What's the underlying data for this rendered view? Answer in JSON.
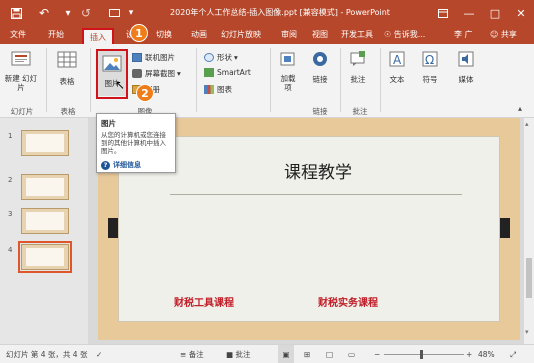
{
  "titlebar": {
    "title": "2020年个人工作总结-插入图像.ppt [兼容模式] - PowerPoint",
    "save_icon": "save-icon",
    "undo_icon": "undo-icon",
    "redo_icon": "redo-icon",
    "start_icon": "slideshow-start-icon"
  },
  "tabs": [
    "文件",
    "开始",
    "插入",
    "设计",
    "切换",
    "动画",
    "幻灯片放映",
    "审阅",
    "视图",
    "开发工具"
  ],
  "active_tab": "插入",
  "tellme": "告诉我...",
  "user": "李 广",
  "share": "共享",
  "ribbon": {
    "new_slide": "新建\n幻灯片",
    "table": "表格",
    "picture": "图片",
    "online_picture": "联机图片",
    "screenshot": "屏幕截图",
    "album": "相册",
    "shapes": "形状",
    "smartart": "SmartArt",
    "chart": "图表",
    "addins": "加载\n项",
    "link": "链接",
    "comment": "批注",
    "text": "文本",
    "symbol": "符号",
    "media": "媒体",
    "groups": {
      "slides": "幻灯片",
      "tables": "表格",
      "images": "图像",
      "links": "链接",
      "comments": "批注"
    }
  },
  "tooltip": {
    "title": "图片",
    "desc": "从您的计算机或您连接到的其他计算机中插入图片。",
    "more": "详细信息"
  },
  "thumbnails": [
    "1",
    "2",
    "3",
    "4"
  ],
  "slide": {
    "title": "课程教学",
    "sub_left": "财税工具课程",
    "sub_right": "财税实务课程"
  },
  "status": {
    "slide_info": "幻灯片 第 4 张，共 4 张",
    "notes": "备注",
    "comments": "批注",
    "zoom": "48%"
  },
  "badges": [
    "1",
    "2"
  ],
  "colors": {
    "accent": "#b7472a",
    "badge": "#ee7d1a",
    "highlight": "#d0121b",
    "slide_subtitle": "#c0202a"
  }
}
